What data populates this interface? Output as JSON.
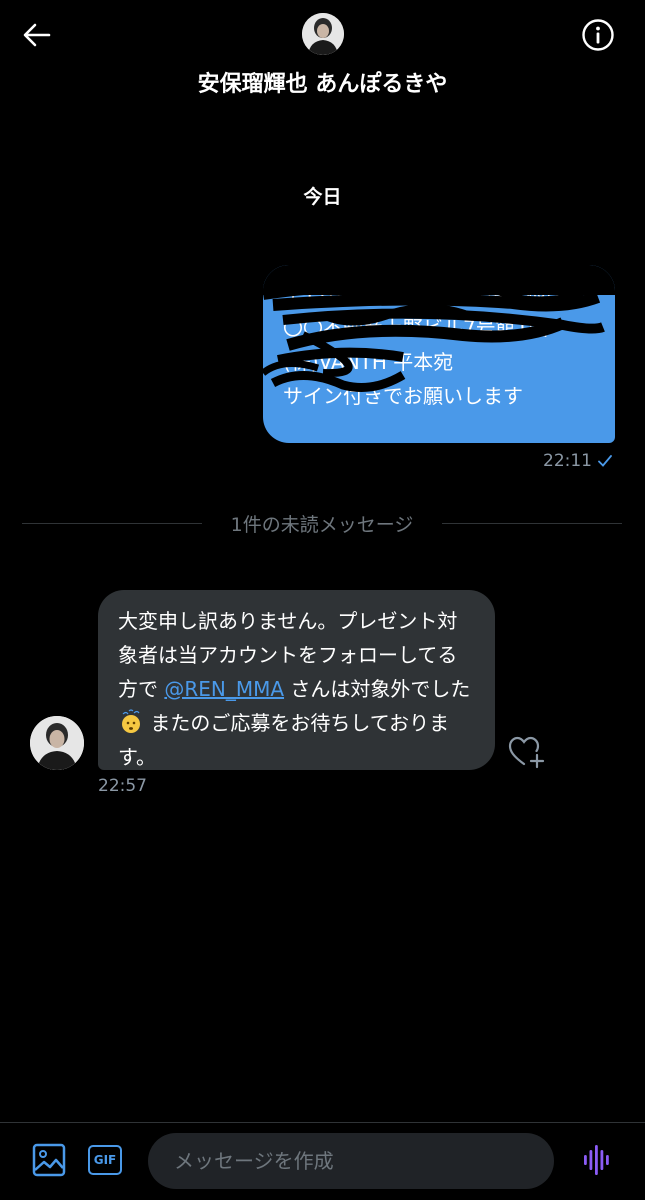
{
  "header": {
    "contact_name": "安保瑠輝也 あんぽるきや",
    "back_icon": "back-arrow-icon",
    "info_icon": "info-icon"
  },
  "conversation": {
    "date_label": "今日",
    "sent_message": {
      "text": "〒110-0000 東京都台東区根岸\n〇〇不動産上野ビル7号館1階\n(株)VANTH 平本宛\nサイン付きでお願いします",
      "time": "22:11",
      "status_icon": "check-icon"
    },
    "unread_divider": "1件の未読メッセージ",
    "received_message": {
      "text_before": "大変申し訳ありません。プレゼント対象者は当アカウントをフォローしてる方で ",
      "mention": "@REN_MMA",
      "text_middle": " さんは対象外でした",
      "emoji": "dizzy-face-emoji",
      "text_after": " またのご応募をお待ちしております。",
      "time": "22:57"
    }
  },
  "composer": {
    "placeholder": "メッセージを作成",
    "gif_label": "GIF"
  },
  "colors": {
    "background": "#000000",
    "sent_bubble": "#4a99e9",
    "received_bubble": "#2f3336",
    "accent": "#4a99e9",
    "voice_accent": "#8b5cf6",
    "muted_text": "#8b98a5"
  }
}
